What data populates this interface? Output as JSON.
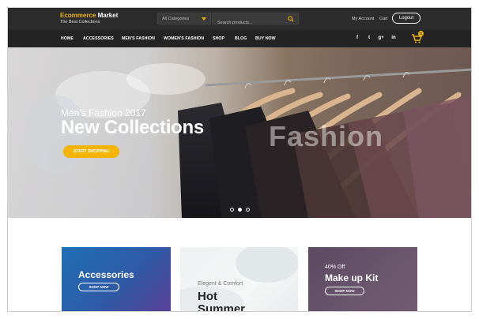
{
  "header": {
    "brand_name_accent": "Ecommerce",
    "brand_name_rest": " Market",
    "brand_tagline": "The Best Collections",
    "category_select": "All Categories",
    "search_placeholder": "Search products...",
    "my_account": "My Account",
    "cart_link": "Cart",
    "logout": "Logout"
  },
  "nav": {
    "items": [
      "HOME",
      "ACCESSORIES",
      "MEN'S FASHION",
      "WOMEN'S FASHION",
      "SHOP",
      "BLOG",
      "BUY NOW"
    ],
    "social": [
      "f",
      "t",
      "g+",
      "in"
    ],
    "cart_count": "0"
  },
  "hero": {
    "kicker": "Men's Fashion 2017",
    "title": "New Collections",
    "watermark": "Fashion",
    "cta": "START SHOPPING"
  },
  "promos": [
    {
      "title": "Accessories",
      "cta": "SHOP NOW"
    },
    {
      "subtitle": "Elegent & Comfort",
      "title_line1": "Hot",
      "title_line2": "Summer"
    },
    {
      "offer": "40% Off",
      "title": "Make up Kit",
      "cta": "SHOP NOW"
    }
  ],
  "colors": {
    "accent": "#f0b400",
    "topbar": "#2c2c2c",
    "navbar": "#242424"
  }
}
